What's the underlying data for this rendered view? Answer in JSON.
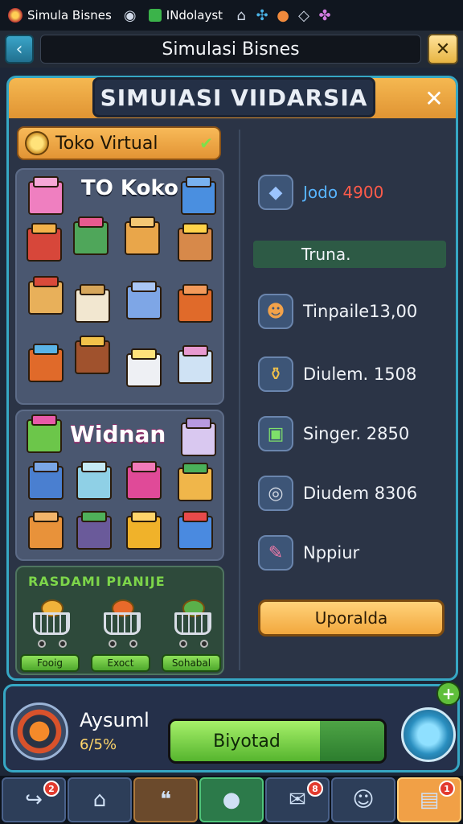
{
  "statusbar": {
    "tab1": "Simula Bisnes",
    "tab2": "INdolayst"
  },
  "titlebar": {
    "title": "Simulasi Bisnes"
  },
  "panel": {
    "title": "SIMUIASI VIIDARSIA",
    "tab_label": "Toko Virtual",
    "shop_title": "TO Koko",
    "section2_title": "Widnan",
    "section3_title": "RASDAMI PIANIJE",
    "cart_buttons": [
      "Fooig",
      "Exoct",
      "Sohabal"
    ]
  },
  "stats": {
    "top_a": "Jodo",
    "top_b": "4900",
    "band": "Truna.",
    "row1": "Tinpaile13,00",
    "row2": "Diulem. 1508",
    "row3": "Singer. 2850",
    "row4": "Diudem 8306",
    "row5": "Nppiur",
    "upgrade": "Uporalda"
  },
  "hud": {
    "name": "Aysuml",
    "value": "6/5%",
    "progress_label": "Biyotad",
    "progress_fraction": 0.7
  },
  "nav": {
    "badges": [
      "2",
      "8",
      "1"
    ]
  }
}
